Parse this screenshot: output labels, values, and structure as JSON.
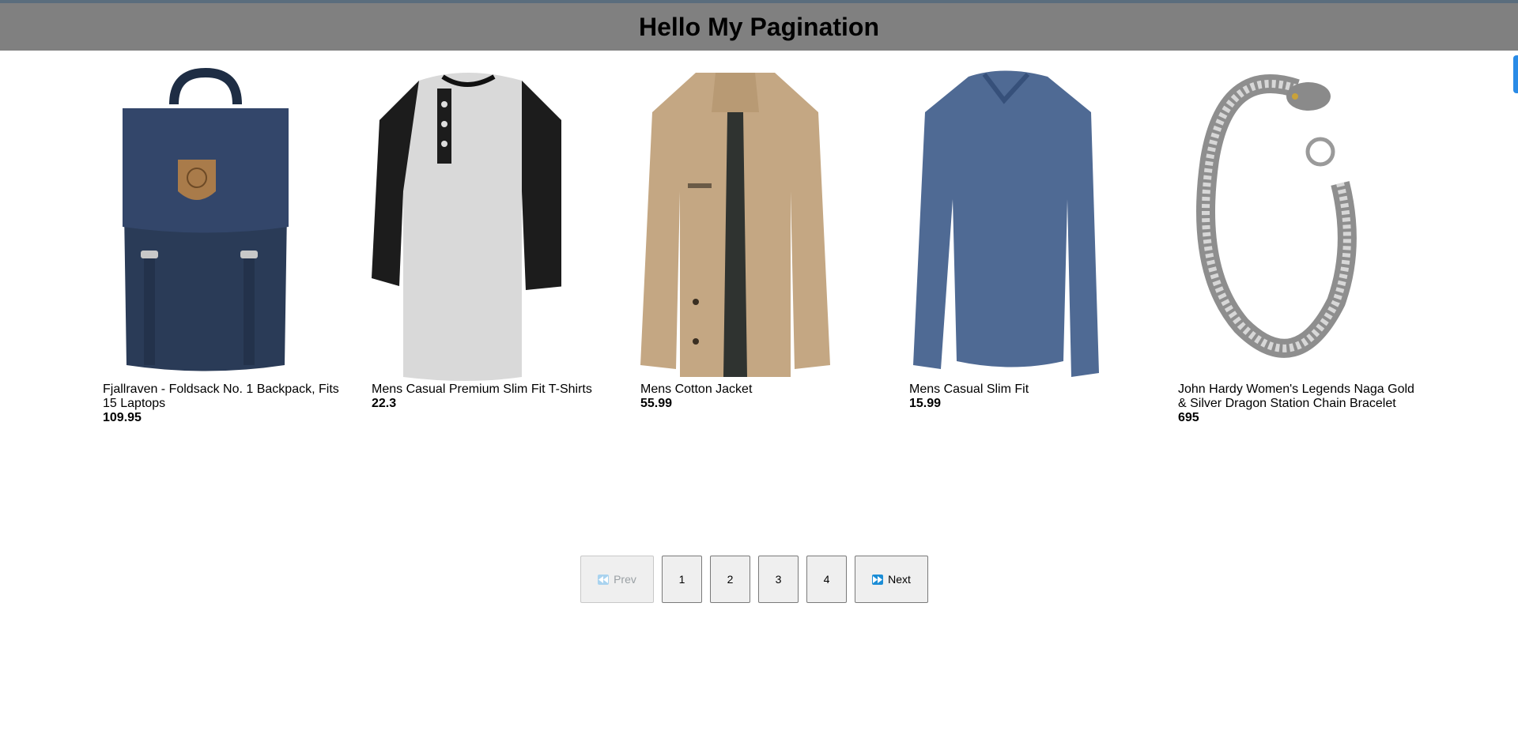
{
  "header": {
    "title": "Hello My Pagination"
  },
  "products": [
    {
      "title": "Fjallraven - Foldsack No. 1 Backpack, Fits 15 Laptops",
      "price": "109.95",
      "image": "navy-backpack"
    },
    {
      "title": "Mens Casual Premium Slim Fit T-Shirts",
      "price": "22.3",
      "image": "raglan-henley-shirt"
    },
    {
      "title": "Mens Cotton Jacket",
      "price": "55.99",
      "image": "tan-cotton-jacket"
    },
    {
      "title": "Mens Casual Slim Fit",
      "price": "15.99",
      "image": "blue-longsleeve-shirt"
    },
    {
      "title": "John Hardy Women's Legends Naga Gold & Silver Dragon Station Chain Bracelet",
      "price": "695",
      "image": "dragon-chain-bracelet"
    }
  ],
  "pagination": {
    "prev_label": "Prev",
    "next_label": "Next",
    "pages": [
      "1",
      "2",
      "3",
      "4"
    ],
    "prev_disabled": true,
    "prev_icon": "rewind-icon",
    "next_icon": "fast-forward-icon"
  },
  "colors": {
    "header_bg": "#808080",
    "top_strip": "#5a6d7d",
    "scroll_tab": "#2a8be6",
    "next_icon": "#1b8dd6",
    "prev_icon_disabled": "#a9d3ef"
  }
}
